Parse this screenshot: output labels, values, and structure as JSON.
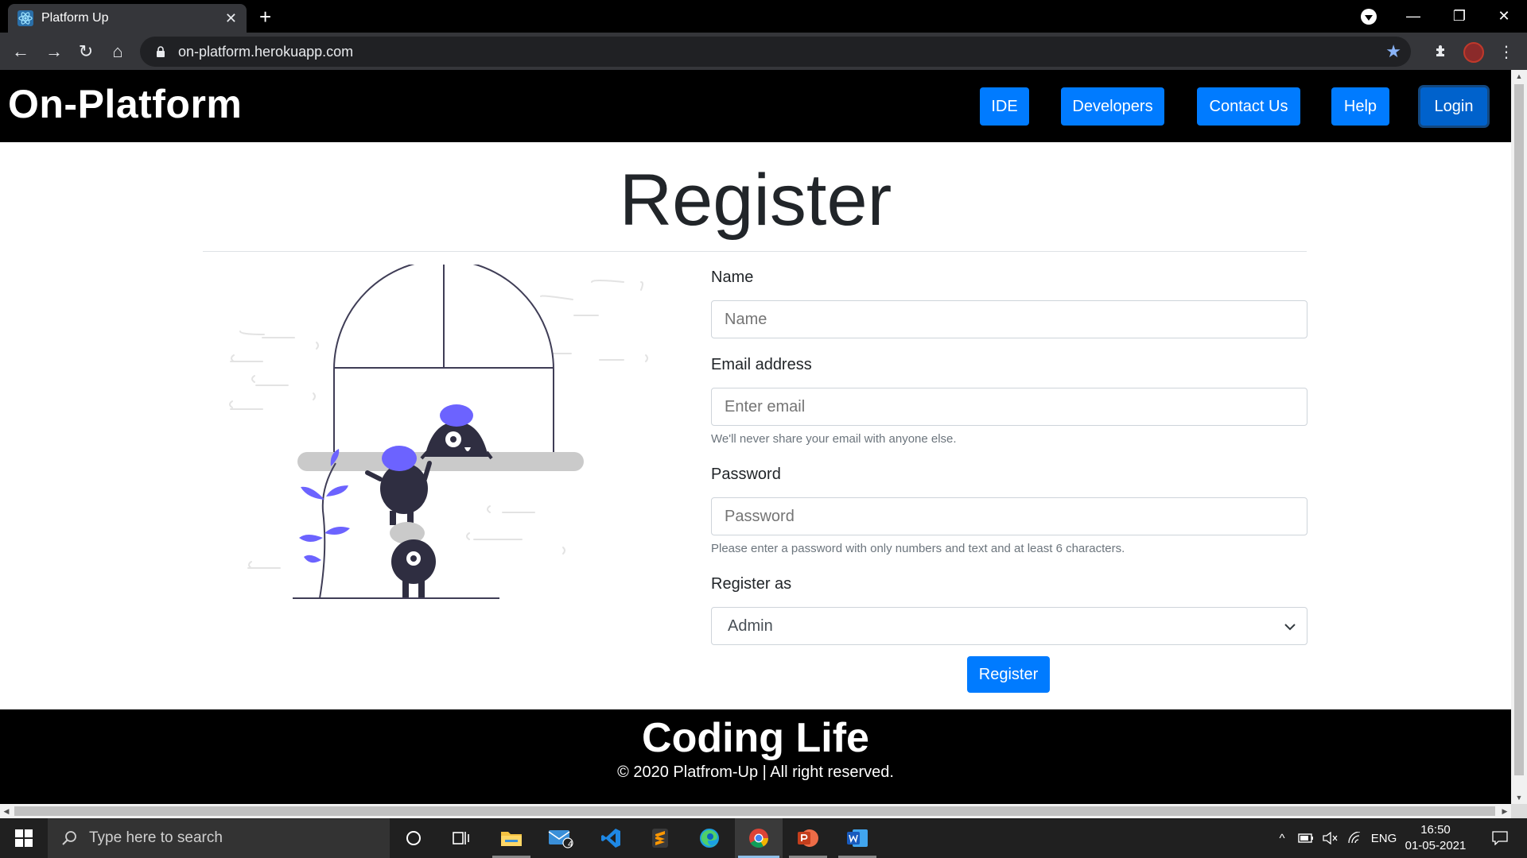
{
  "browser": {
    "tab_title": "Platform Up",
    "url": "on-platform.herokuapp.com"
  },
  "site": {
    "brand": "On-Platform",
    "nav": [
      {
        "label": "IDE"
      },
      {
        "label": "Developers"
      },
      {
        "label": "Contact Us"
      },
      {
        "label": "Help"
      },
      {
        "label": "Login"
      }
    ]
  },
  "register": {
    "title": "Register",
    "name_label": "Name",
    "name_placeholder": "Name",
    "email_label": "Email address",
    "email_placeholder": "Enter email",
    "email_help": "We'll never share your email with anyone else.",
    "password_label": "Password",
    "password_placeholder": "Password",
    "password_help": "Please enter a password with only numbers and text and at least 6 characters.",
    "role_label": "Register as",
    "role_selected": "Admin",
    "submit_label": "Register"
  },
  "footer": {
    "title": "Coding Life",
    "copyright": "© 2020 Platfrom-Up | All right reserved."
  },
  "taskbar": {
    "search_placeholder": "Type here to search",
    "mail_badge": "4",
    "language": "ENG",
    "time": "16:50",
    "date": "01-05-2021"
  },
  "colors": {
    "primary": "#007bff",
    "illustration_accent": "#6c63ff",
    "illustration_dark": "#2f2e41"
  }
}
